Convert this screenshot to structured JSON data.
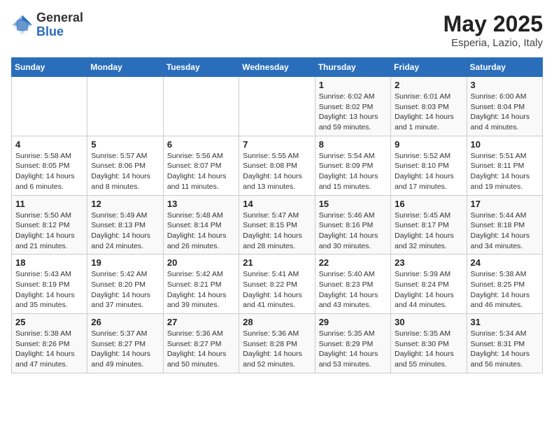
{
  "header": {
    "logo_general": "General",
    "logo_blue": "Blue",
    "title": "May 2025",
    "subtitle": "Esperia, Lazio, Italy"
  },
  "days_of_week": [
    "Sunday",
    "Monday",
    "Tuesday",
    "Wednesday",
    "Thursday",
    "Friday",
    "Saturday"
  ],
  "weeks": [
    [
      {
        "day": "",
        "info": ""
      },
      {
        "day": "",
        "info": ""
      },
      {
        "day": "",
        "info": ""
      },
      {
        "day": "",
        "info": ""
      },
      {
        "day": "1",
        "info": "Sunrise: 6:02 AM\nSunset: 8:02 PM\nDaylight: 13 hours and 59 minutes."
      },
      {
        "day": "2",
        "info": "Sunrise: 6:01 AM\nSunset: 8:03 PM\nDaylight: 14 hours and 1 minute."
      },
      {
        "day": "3",
        "info": "Sunrise: 6:00 AM\nSunset: 8:04 PM\nDaylight: 14 hours and 4 minutes."
      }
    ],
    [
      {
        "day": "4",
        "info": "Sunrise: 5:58 AM\nSunset: 8:05 PM\nDaylight: 14 hours and 6 minutes."
      },
      {
        "day": "5",
        "info": "Sunrise: 5:57 AM\nSunset: 8:06 PM\nDaylight: 14 hours and 8 minutes."
      },
      {
        "day": "6",
        "info": "Sunrise: 5:56 AM\nSunset: 8:07 PM\nDaylight: 14 hours and 11 minutes."
      },
      {
        "day": "7",
        "info": "Sunrise: 5:55 AM\nSunset: 8:08 PM\nDaylight: 14 hours and 13 minutes."
      },
      {
        "day": "8",
        "info": "Sunrise: 5:54 AM\nSunset: 8:09 PM\nDaylight: 14 hours and 15 minutes."
      },
      {
        "day": "9",
        "info": "Sunrise: 5:52 AM\nSunset: 8:10 PM\nDaylight: 14 hours and 17 minutes."
      },
      {
        "day": "10",
        "info": "Sunrise: 5:51 AM\nSunset: 8:11 PM\nDaylight: 14 hours and 19 minutes."
      }
    ],
    [
      {
        "day": "11",
        "info": "Sunrise: 5:50 AM\nSunset: 8:12 PM\nDaylight: 14 hours and 21 minutes."
      },
      {
        "day": "12",
        "info": "Sunrise: 5:49 AM\nSunset: 8:13 PM\nDaylight: 14 hours and 24 minutes."
      },
      {
        "day": "13",
        "info": "Sunrise: 5:48 AM\nSunset: 8:14 PM\nDaylight: 14 hours and 26 minutes."
      },
      {
        "day": "14",
        "info": "Sunrise: 5:47 AM\nSunset: 8:15 PM\nDaylight: 14 hours and 28 minutes."
      },
      {
        "day": "15",
        "info": "Sunrise: 5:46 AM\nSunset: 8:16 PM\nDaylight: 14 hours and 30 minutes."
      },
      {
        "day": "16",
        "info": "Sunrise: 5:45 AM\nSunset: 8:17 PM\nDaylight: 14 hours and 32 minutes."
      },
      {
        "day": "17",
        "info": "Sunrise: 5:44 AM\nSunset: 8:18 PM\nDaylight: 14 hours and 34 minutes."
      }
    ],
    [
      {
        "day": "18",
        "info": "Sunrise: 5:43 AM\nSunset: 8:19 PM\nDaylight: 14 hours and 35 minutes."
      },
      {
        "day": "19",
        "info": "Sunrise: 5:42 AM\nSunset: 8:20 PM\nDaylight: 14 hours and 37 minutes."
      },
      {
        "day": "20",
        "info": "Sunrise: 5:42 AM\nSunset: 8:21 PM\nDaylight: 14 hours and 39 minutes."
      },
      {
        "day": "21",
        "info": "Sunrise: 5:41 AM\nSunset: 8:22 PM\nDaylight: 14 hours and 41 minutes."
      },
      {
        "day": "22",
        "info": "Sunrise: 5:40 AM\nSunset: 8:23 PM\nDaylight: 14 hours and 43 minutes."
      },
      {
        "day": "23",
        "info": "Sunrise: 5:39 AM\nSunset: 8:24 PM\nDaylight: 14 hours and 44 minutes."
      },
      {
        "day": "24",
        "info": "Sunrise: 5:38 AM\nSunset: 8:25 PM\nDaylight: 14 hours and 46 minutes."
      }
    ],
    [
      {
        "day": "25",
        "info": "Sunrise: 5:38 AM\nSunset: 8:26 PM\nDaylight: 14 hours and 47 minutes."
      },
      {
        "day": "26",
        "info": "Sunrise: 5:37 AM\nSunset: 8:27 PM\nDaylight: 14 hours and 49 minutes."
      },
      {
        "day": "27",
        "info": "Sunrise: 5:36 AM\nSunset: 8:27 PM\nDaylight: 14 hours and 50 minutes."
      },
      {
        "day": "28",
        "info": "Sunrise: 5:36 AM\nSunset: 8:28 PM\nDaylight: 14 hours and 52 minutes."
      },
      {
        "day": "29",
        "info": "Sunrise: 5:35 AM\nSunset: 8:29 PM\nDaylight: 14 hours and 53 minutes."
      },
      {
        "day": "30",
        "info": "Sunrise: 5:35 AM\nSunset: 8:30 PM\nDaylight: 14 hours and 55 minutes."
      },
      {
        "day": "31",
        "info": "Sunrise: 5:34 AM\nSunset: 8:31 PM\nDaylight: 14 hours and 56 minutes."
      }
    ]
  ]
}
